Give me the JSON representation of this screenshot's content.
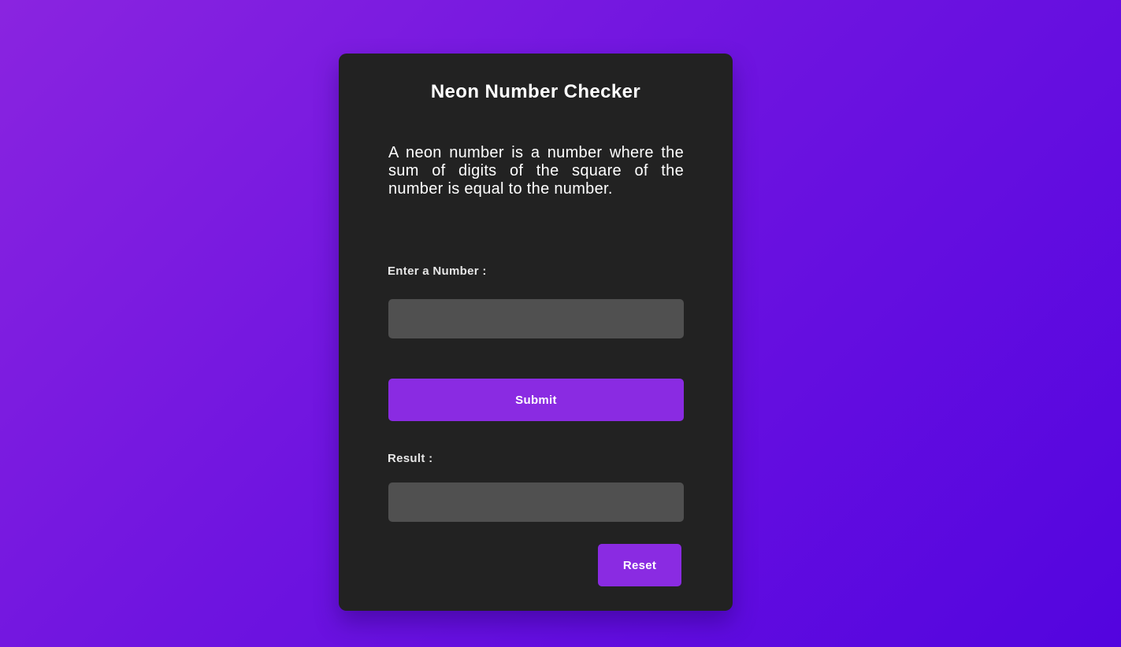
{
  "app": {
    "title": "Neon Number Checker",
    "description": "A neon number is a number where the sum of digits of the square of the number is equal to the number."
  },
  "form": {
    "number_label": "Enter a Number :",
    "number_value": "",
    "number_placeholder": "",
    "submit_label": "Submit",
    "result_label": "Result :",
    "result_value": "",
    "reset_label": "Reset"
  },
  "colors": {
    "background_start": "#8a24e0",
    "background_end": "#5304df",
    "card": "#222222",
    "field": "#505050",
    "accent": "#8a2be2",
    "text": "#ffffff"
  }
}
